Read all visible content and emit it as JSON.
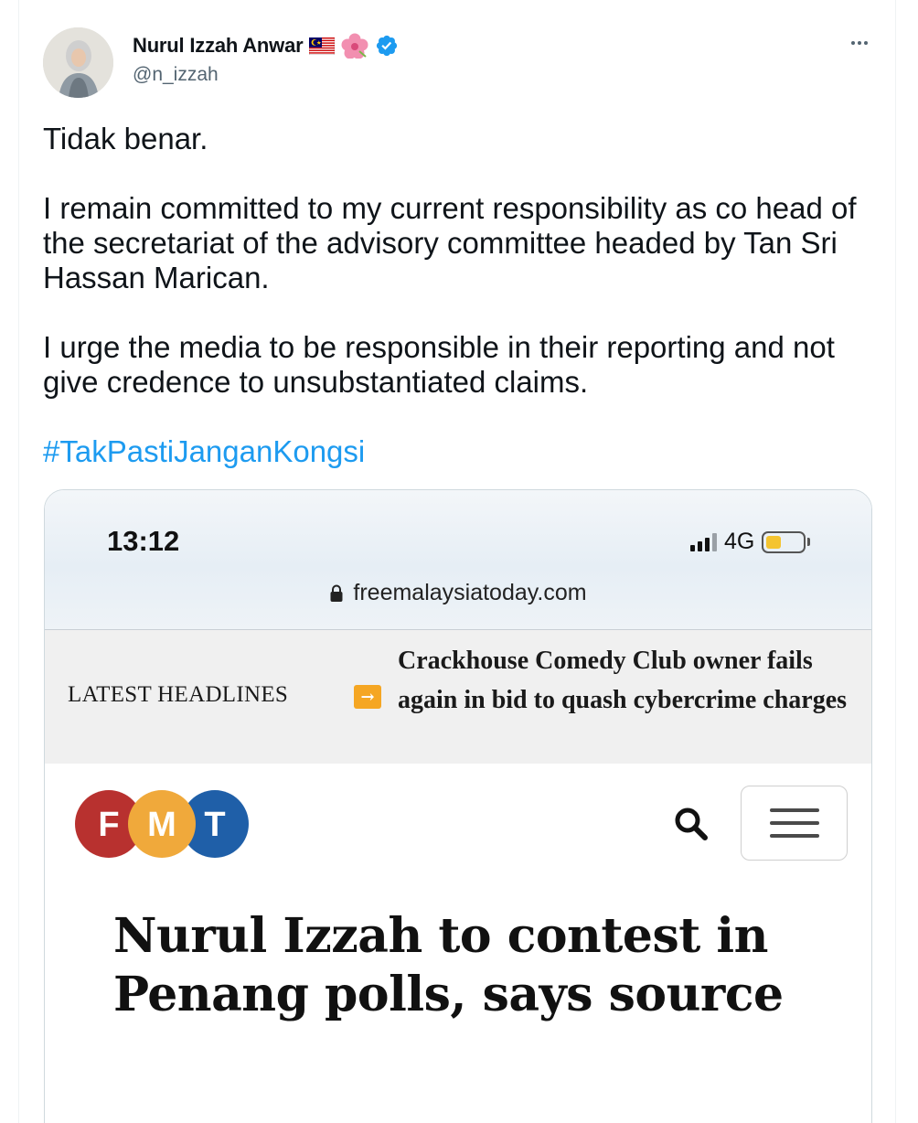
{
  "tweet": {
    "author": {
      "display_name": "Nurul Izzah Anwar",
      "handle": "@n_izzah",
      "emoji": [
        "malaysia-flag",
        "hibiscus"
      ],
      "verified": true,
      "verified_color": "#1d9bf0"
    },
    "paragraphs": [
      "Tidak benar.",
      "I remain committed to my current responsibility as co head of the secretariat of the advisory committee headed by Tan Sri Hassan Marican.",
      "I urge the media to be responsible in their reporting and not give credence to unsubstantiated claims."
    ],
    "hashtag": "#TakPastiJanganKongsi",
    "hashtag_color": "#1d9bf0"
  },
  "screenshot": {
    "status_bar": {
      "time": "13:12",
      "network": "4G"
    },
    "url": "freemalaysiatoday.com",
    "latest_headlines": {
      "label": "LATEST HEADLINES",
      "headline": "Crackhouse Comedy Club owner fails again in bid to quash cybercrime charges"
    },
    "logo": {
      "letters": [
        "F",
        "M",
        "T"
      ],
      "colors": [
        "#b8312f",
        "#f0a93b",
        "#1f5fa8"
      ]
    },
    "article_title": "Nurul Izzah to contest in Penang polls, says source"
  }
}
